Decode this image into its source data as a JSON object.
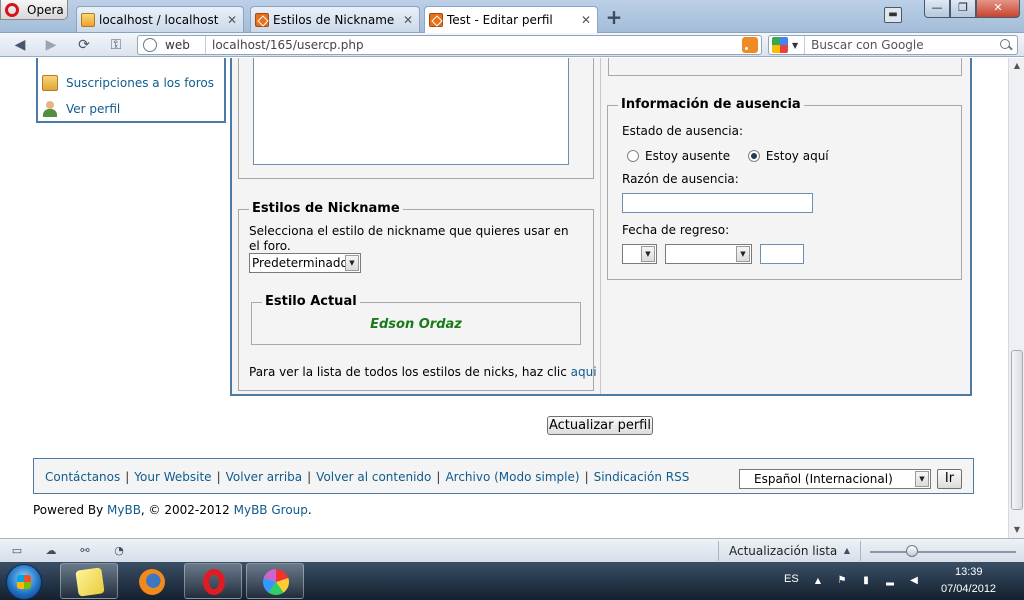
{
  "browser": {
    "menu_label": "Opera",
    "tabs": [
      {
        "label": "localhost / localhost / ...",
        "close": "✕"
      },
      {
        "label": "Estilos de Nickname",
        "close": "✕"
      },
      {
        "label": "Test - Editar perfil",
        "close": "✕"
      }
    ],
    "new_tab": "+",
    "address": {
      "zone_label": "web",
      "url": "localhost/165/usercp.php"
    },
    "search": {
      "placeholder": "Buscar con Google"
    }
  },
  "sidebar": {
    "items": [
      {
        "label": "Suscripciones a los foros",
        "icon": "subscriptions-icon"
      },
      {
        "label": "Ver perfil",
        "icon": "user-profile-icon"
      }
    ]
  },
  "nickname_styles": {
    "legend": "Estilos de Nickname",
    "description": "Selecciona el estilo de nickname que quieres usar en el foro.",
    "select_value": "Predeterminado",
    "current_style_legend": "Estilo Actual",
    "current_style_preview": "Edson Ordaz",
    "preview_color": "#1a7a1a",
    "list_text": "Para ver la lista de todos los estilos de nicks, haz clic",
    "list_link": "aqui"
  },
  "away": {
    "legend": "Información de ausencia",
    "status_label": "Estado de ausencia:",
    "option_away": "Estoy ausente",
    "option_here": "Estoy aquí",
    "selected": "here",
    "reason_label": "Razón de ausencia:",
    "reason_value": "",
    "return_label": "Fecha de regreso:",
    "day_value": "",
    "month_value": "",
    "year_value": ""
  },
  "update_button": "Actualizar perfil",
  "footer": {
    "links": [
      "Contáctanos",
      "Your Website",
      "Volver arriba",
      "Volver al contenido",
      "Archivo (Modo simple)",
      "Sindicación RSS"
    ],
    "language_value": "Español (Internacional)",
    "go_button": "Ir",
    "powered_prefix": "Powered By",
    "powered_link": "MyBB",
    "copyright": ", © 2002-2012",
    "group_link": "MyBB Group",
    "period": "."
  },
  "statusbar": {
    "text": "Actualización lista"
  },
  "taskbar": {
    "lang": "ES",
    "time": "13:39",
    "date": "07/04/2012"
  },
  "colors": {
    "accent_border": "#4b7ba6",
    "link": "#0f5c8e",
    "panel_bg": "#f4f4f4"
  }
}
